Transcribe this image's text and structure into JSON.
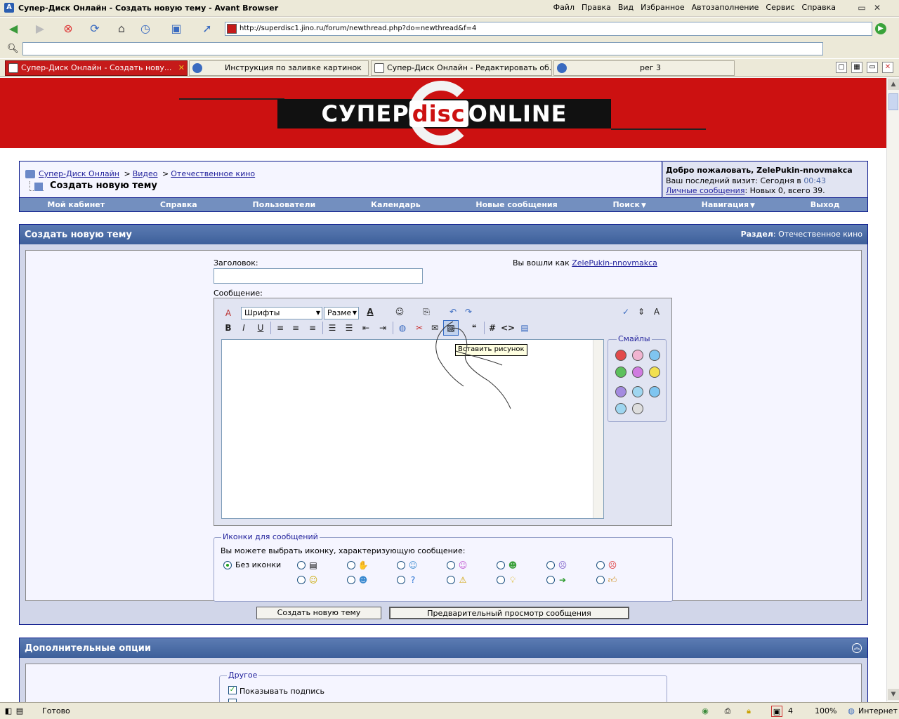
{
  "window": {
    "title": "Супер-Диск Онлайн - Создать новую тему - Avant Browser",
    "logo_letter": "A",
    "menu": [
      "Файл",
      "Правка",
      "Вид",
      "Избранное",
      "Автозаполнение",
      "Сервис",
      "Справка"
    ]
  },
  "address": {
    "url": "http://superdisc1.jino.ru/forum/newthread.php?do=newthread&f=4"
  },
  "tabs": [
    {
      "label": "Супер-Диск Онлайн - Создать нову...",
      "active": true
    },
    {
      "label": "Инструкция по заливке картинок",
      "active": false
    },
    {
      "label": "Супер-Диск Онлайн - Редактировать об...",
      "active": false
    },
    {
      "label": "рег 3",
      "active": false
    }
  ],
  "banner": {
    "left": "СУПЕР",
    "disc": "disc",
    "right": "ONLINE"
  },
  "breadcrumb": {
    "items": [
      "Супер-Диск Онлайн",
      "Видео",
      "Отечественное кино"
    ],
    "separator": ">",
    "current": "Создать новую тему"
  },
  "welcome": {
    "title": "Добро пожаловать, ZelePukin-nnovmakca",
    "last_visit_prefix": "Ваш последний визит: Сегодня в ",
    "last_visit_time": "00:43",
    "pm_link": "Личные сообщения",
    "pm_status": ": Новых 0, всего 39."
  },
  "navrow": [
    "Мой кабинет",
    "Справка",
    "Пользователи",
    "Календарь",
    "Новые сообщения",
    "Поиск",
    "Навигация",
    "Выход"
  ],
  "panel": {
    "title": "Создать новую тему",
    "section_label": "Раздел",
    "section_value": ": Отечественное кино"
  },
  "form": {
    "subject_label": "Заголовок:",
    "subject_value": "",
    "logged_in_prefix": "Вы вошли как ",
    "logged_in_user": "ZelePukin-nnovmakca",
    "message_label": "Сообщение:",
    "font_select": "Шрифты",
    "size_select": "Разме",
    "tooltip": "Вставить рисунок",
    "smilies_label": "Смайлы"
  },
  "post_icons": {
    "legend": "Иконки для сообщений",
    "description": "Вы можете выбрать иконку, характеризующую сообщение:",
    "no_icon": "Без иконки"
  },
  "buttons": {
    "submit": "Создать новую тему",
    "preview": "Предварительный просмотр сообщения"
  },
  "options": {
    "title": "Дополнительные опции",
    "other_legend": "Другое",
    "show_signature": "Показывать подпись"
  },
  "status": {
    "text": "Готово",
    "popups": "4",
    "zoom": "100%",
    "zone": "Интернет"
  },
  "colors": {
    "banner_red": "#cc1111",
    "forum_blue": "#0b198c",
    "nav_blue": "#738fbf",
    "header_blue": "#4d6da6"
  }
}
